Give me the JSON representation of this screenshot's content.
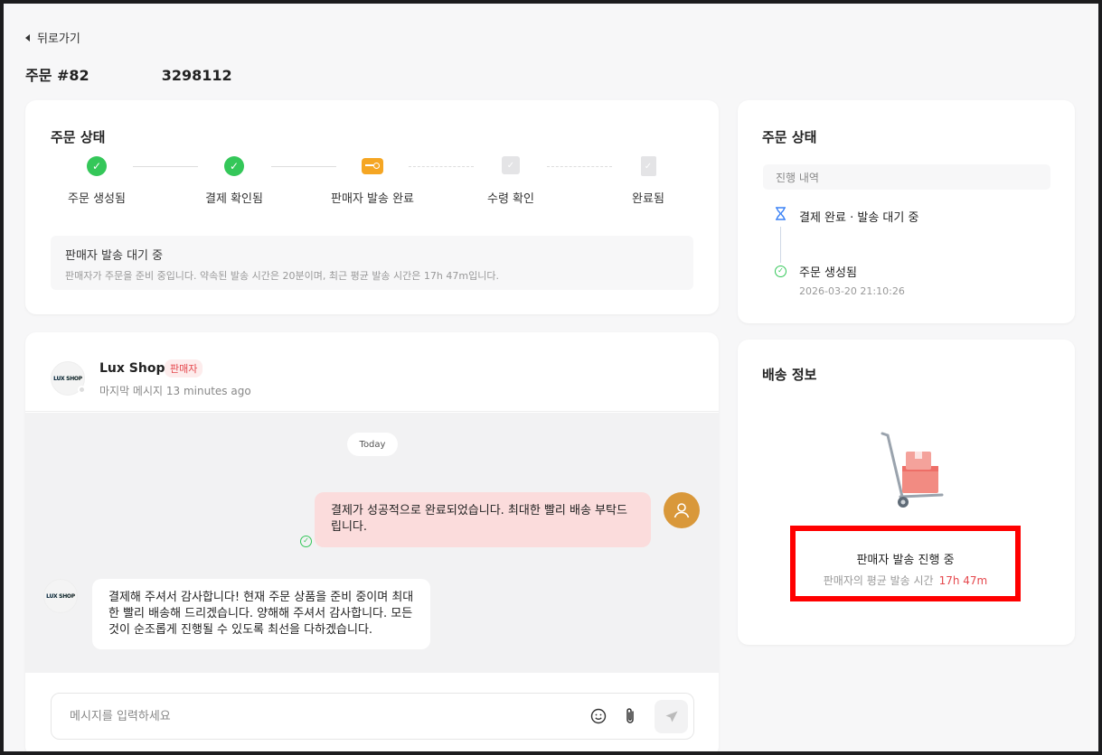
{
  "nav": {
    "back_label": "뒤로가기"
  },
  "order": {
    "title_prefix": "주문 #82",
    "title_suffix": "3298112"
  },
  "progress": {
    "title": "주문 상태",
    "steps": [
      {
        "label": "주문 생성됨",
        "state": "done"
      },
      {
        "label": "결제 확인됨",
        "state": "done"
      },
      {
        "label": "판매자 발송 완료",
        "state": "current"
      },
      {
        "label": "수령 확인",
        "state": "pending"
      },
      {
        "label": "완료됨",
        "state": "pending"
      }
    ],
    "notice_title": "판매자 발송 대기 중",
    "notice_desc": "판매자가 주문을 준비 중입니다. 약속된 발송 시간은 20분이며, 최근 평균 발송 시간은 17h 47m입니다."
  },
  "chat": {
    "shop_name": "Lux Shop",
    "shop_logo_text": "LUX SHOP",
    "seller_badge": "판매자",
    "last_message": "마지막 메시지 13 minutes ago",
    "date_chip": "Today",
    "messages": [
      {
        "from": "me",
        "text": "결제가 성공적으로 완료되었습니다. 최대한 빨리 배송 부탁드립니다."
      },
      {
        "from": "shop",
        "text": "결제해 주셔서 감사합니다! 현재 주문 상품을 준비 중이며 최대한 빨리 배송해 드리겠습니다. 양해해 주셔서 감사합니다. 모든 것이 순조롭게 진행될 수 있도록 최선을 다하겠습니다."
      }
    ],
    "input_placeholder": "메시지를 입력하세요"
  },
  "status_panel": {
    "title": "주문 상태",
    "history_label": "진행 내역",
    "timeline": [
      {
        "text": "결제 완료 · 발송 대기 중",
        "icon": "hourglass-icon"
      },
      {
        "text": "주문 생성됨",
        "date": "2026-03-20 21:10:26",
        "icon": "check-circle-icon"
      }
    ]
  },
  "shipping": {
    "title": "배송 정보",
    "status": "판매자 발송 진행 중",
    "avg_label": "판매자의 평균 발송 시간",
    "avg_value": "17h 47m"
  },
  "colors": {
    "success": "#34c759",
    "accent_red": "#e5484d",
    "pending_orange": "#f5a623",
    "highlight": "#ff0000"
  }
}
